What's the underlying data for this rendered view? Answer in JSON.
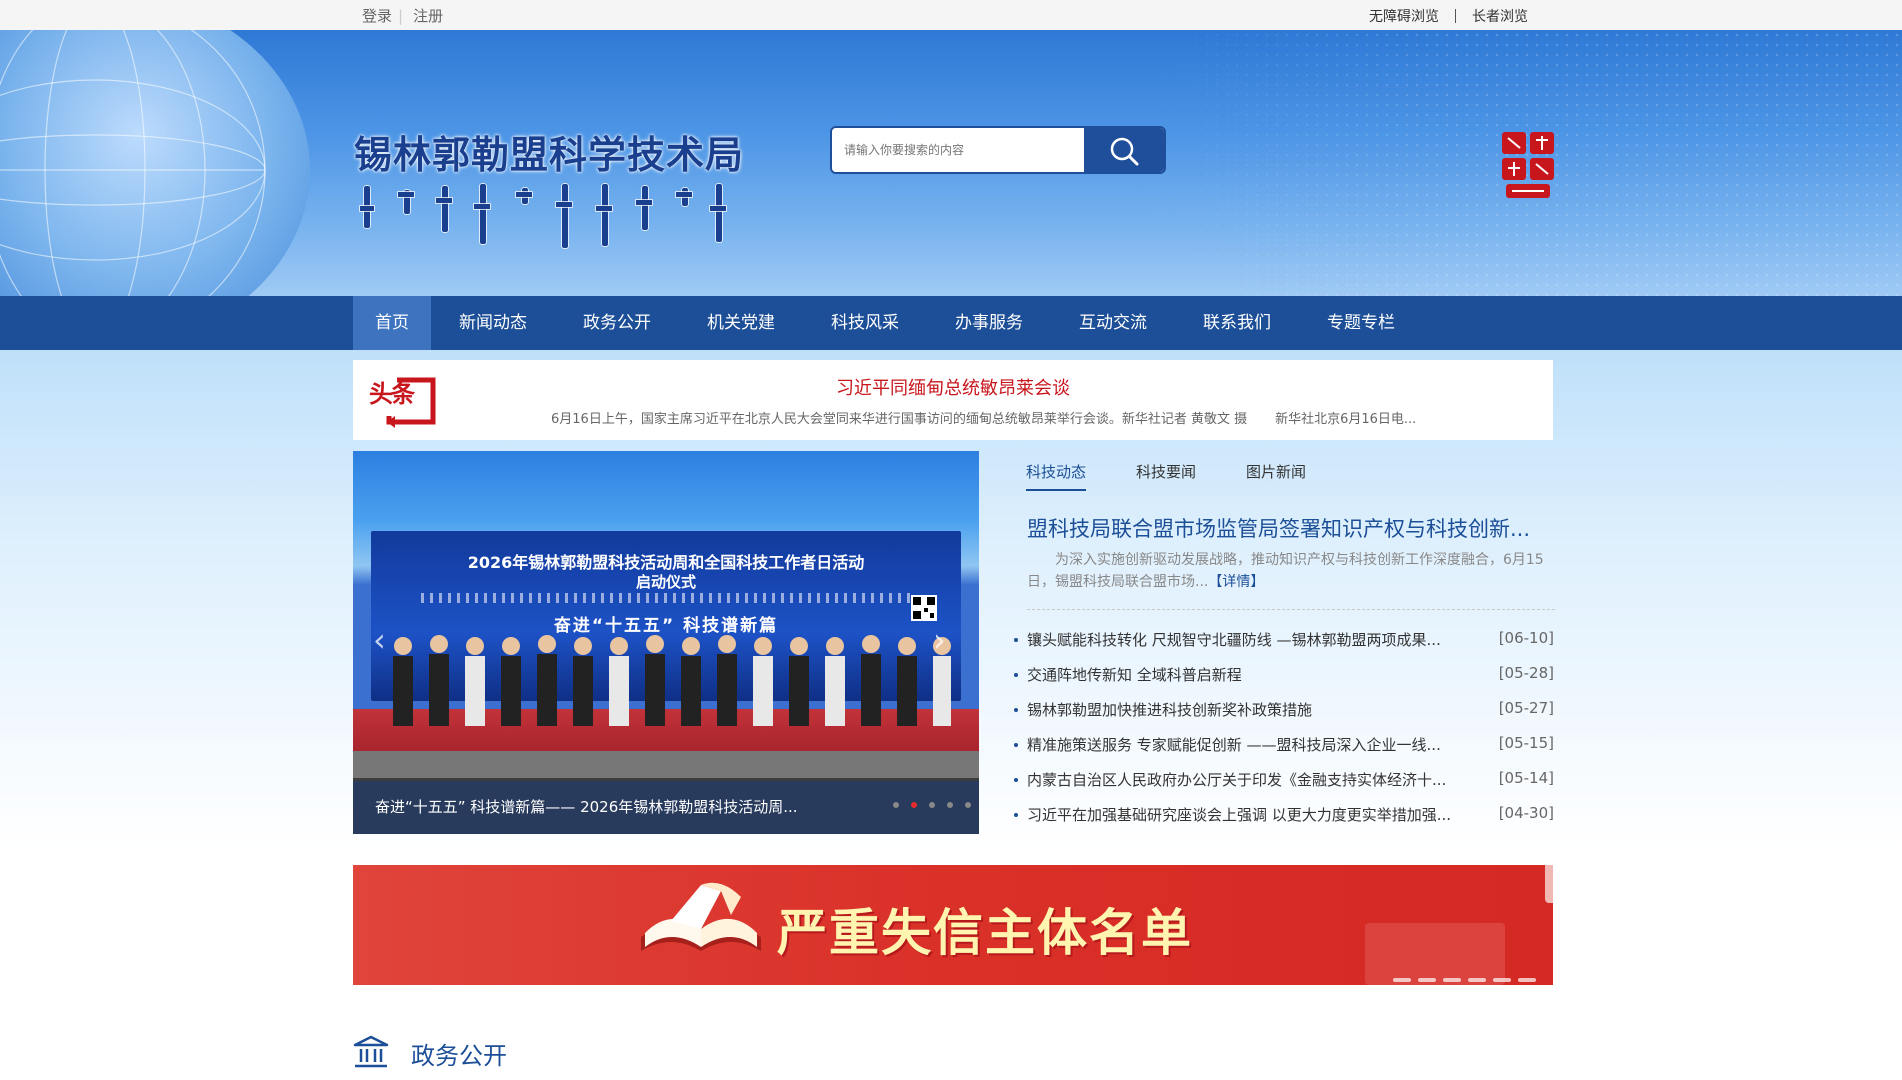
{
  "topbar": {
    "login": "登录",
    "register": "注册",
    "accessible": "无障碍浏览",
    "elder": "长者浏览"
  },
  "header": {
    "title": "锡林郭勒盟科学技术局",
    "search_placeholder": "请输入你要搜索的内容"
  },
  "nav": {
    "items": [
      {
        "label": "首页"
      },
      {
        "label": "新闻动态"
      },
      {
        "label": "政务公开"
      },
      {
        "label": "机关党建"
      },
      {
        "label": "科技风采"
      },
      {
        "label": "办事服务"
      },
      {
        "label": "互动交流"
      },
      {
        "label": "联系我们"
      },
      {
        "label": "专题专栏"
      }
    ]
  },
  "headline": {
    "badge": "头条",
    "title": "习近平同缅甸总统敏昂莱会谈",
    "sub1": "6月16日上午，国家主席习近平在北京人民大会堂同来华进行国事访问的缅甸总统敏昂莱举行会谈。新华社记者 黄敬文 摄",
    "sub2": "新华社北京6月16日电..."
  },
  "slider": {
    "board_line1": "2026年锡林郭勒盟科技活动周和全国科技工作者日活动",
    "board_line2": "启动仪式",
    "board_line3": "奋进“十五五” 科技谱新篇",
    "caption": "奋进“十五五” 科技谱新篇—— 2026年锡林郭勒盟科技活动周..."
  },
  "news": {
    "tabs": [
      {
        "label": "科技动态"
      },
      {
        "label": "科技要闻"
      },
      {
        "label": "图片新闻"
      }
    ],
    "featured": {
      "title": "盟科技局联合盟市场监管局签署知识产权与科技创新...",
      "summary": "为深入实施创新驱动发展战略，推动知识产权与科技创新工作深度融合，6月15日，锡盟科技局联合盟市场...",
      "more": "【详情】"
    },
    "items": [
      {
        "title": "镶头赋能科技转化 尺规智守北疆防线 —锡林郭勒盟两项成果...",
        "date": "[06-10]"
      },
      {
        "title": "交通阵地传新知 全域科普启新程",
        "date": "[05-28]"
      },
      {
        "title": "锡林郭勒盟加快推进科技创新奖补政策措施",
        "date": "[05-27]"
      },
      {
        "title": "精准施策送服务 专家赋能促创新 ——盟科技局深入企业一线...",
        "date": "[05-15]"
      },
      {
        "title": "内蒙古自治区人民政府办公厅关于印发《金融支持实体经济十...",
        "date": "[05-14]"
      },
      {
        "title": "习近平在加强基础研究座谈会上强调 以更大力度更实举措加强...",
        "date": "[04-30]"
      }
    ]
  },
  "banner": {
    "text": "严重失信主体名单"
  },
  "section": {
    "title": "政务公开"
  },
  "colors": {
    "nav_bg": "#1c4f97",
    "nav_active": "#3e73c0",
    "headline_red": "#c8161d",
    "banner_red": "#d93028"
  }
}
